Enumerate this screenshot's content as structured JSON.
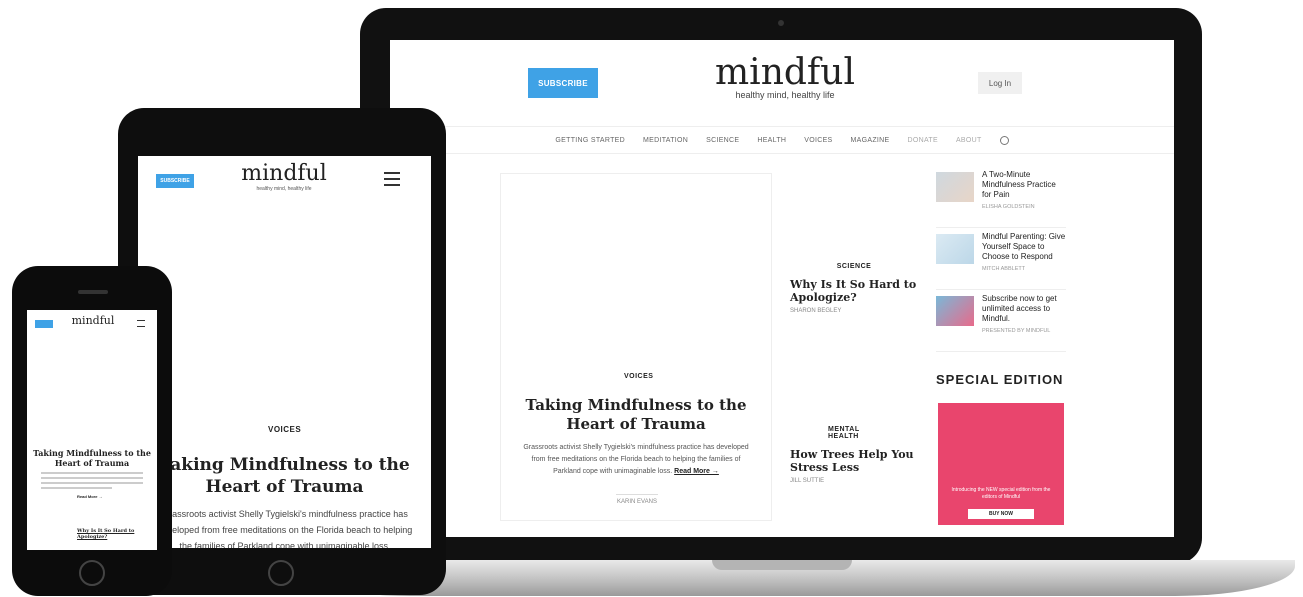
{
  "laptop": {
    "subscribe": "SUBSCRIBE",
    "logo": "mindful",
    "tagline": "healthy mind, healthy life",
    "login": "Log In",
    "nav": [
      "GETTING STARTED",
      "MEDITATION",
      "SCIENCE",
      "HEALTH",
      "VOICES",
      "MAGAZINE",
      "DONATE",
      "ABOUT"
    ],
    "hero": {
      "tag": "VOICES",
      "title": "Taking Mindfulness to the Heart of Trauma",
      "dek": "Grassroots activist Shelly Tygielski's mindfulness practice has developed from free meditations on the Florida beach to helping the families of Parkland cope with unimaginable loss.",
      "read_more": "Read More →",
      "author": "KARIN EVANS"
    },
    "cards": [
      {
        "tag": "SCIENCE",
        "title": "Why Is It So Hard to Apologize?",
        "author": "SHARON BEGLEY"
      },
      {
        "tag": "MENTAL HEALTH",
        "title": "How Trees Help You Stress Less",
        "author": "JILL SUTTIE"
      }
    ],
    "sidebar": [
      {
        "title": "A Two-Minute Mindfulness Practice for Pain",
        "by": "ELISHA GOLDSTEIN"
      },
      {
        "title": "Mindful Parenting: Give Yourself Space to Choose to Respond",
        "by": "MITCH ABBLETT"
      },
      {
        "title": "Subscribe now to get unlimited access to Mindful.",
        "by": "PRESENTED BY MINDFUL"
      }
    ],
    "special_edition": "SPECIAL EDITION",
    "ad": {
      "text": "Introducing the NEW special edition from the editors of Mindful",
      "button": "BUY NOW"
    }
  },
  "tablet": {
    "subscribe": "SUBSCRIBE",
    "logo": "mindful",
    "tagline": "healthy mind, healthy life",
    "tag": "VOICES",
    "title": "Taking Mindfulness to the Heart of Trauma",
    "dek": "Grassroots activist Shelly Tygielski's mindfulness practice has developed from free meditations on the Florida beach to helping the families of Parkland cope with unimaginable loss."
  },
  "phone": {
    "logo": "mindful",
    "title": "Taking Mindfulness to the Heart of Trauma",
    "read_more": "Read More →",
    "card_title": "Why Is It So Hard to Apologize?"
  }
}
